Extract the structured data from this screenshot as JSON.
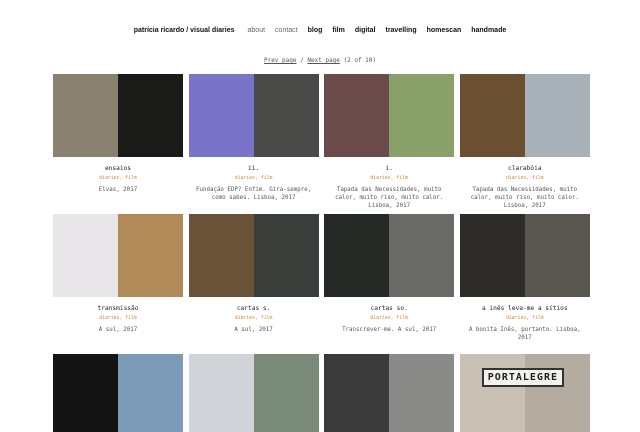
{
  "nav": {
    "site_title": "patrícia ricardo / visual diaries",
    "items": [
      "about",
      "contact",
      "blog",
      "film",
      "digital",
      "travelling",
      "homescan",
      "handmade"
    ]
  },
  "pager": {
    "prev": "Prev page",
    "sep": "/",
    "next": "Next page",
    "count": "(2 of 10)"
  },
  "tag_sep": ",",
  "posts": [
    {
      "title": "ensaios",
      "tags": [
        "diaries",
        "film"
      ],
      "desc": "Elvas, 2017",
      "left": "#8a8070",
      "right": "#1a1a18"
    },
    {
      "title": "ii.",
      "tags": [
        "diaries",
        "film"
      ],
      "desc": "Fundação EDP? Enfim. Gira-sempre, como sabes. Lisboa, 2017",
      "left": "#7a74c8",
      "right": "#4a4a48"
    },
    {
      "title": "i.",
      "tags": [
        "diaries",
        "film"
      ],
      "desc": "Tapada das Necessidades, muito calor, muito riso, muito calor. Lisboa, 2017",
      "left": "#6a4a4a",
      "right": "#8aa06a"
    },
    {
      "title": "clarabóia",
      "tags": [
        "diaries",
        "film"
      ],
      "desc": "Tapada das Necessidades, muito calor, muito riso, muito calor. Lisboa, 2017",
      "left": "#6a5030",
      "right": "#a8b0b8"
    },
    {
      "title": "transmissão",
      "tags": [
        "diaries",
        "film"
      ],
      "desc": "A sul, 2017",
      "left": "#e8e6e8",
      "right": "#b08a58"
    },
    {
      "title": "cartas s.",
      "tags": [
        "diaries",
        "film"
      ],
      "desc": "A sul, 2017",
      "left": "#6a5238",
      "right": "#3a3e3a"
    },
    {
      "title": "cartas so.",
      "tags": [
        "diaries",
        "film"
      ],
      "desc": "Transcrever-me. A sul, 2017",
      "left": "#262a26",
      "right": "#6a6a66"
    },
    {
      "title": "a inês leva-me a sítios",
      "tags": [
        "diaries",
        "film"
      ],
      "desc": "A bonita Inês, portanto. Lisboa, 2017",
      "left": "#2e2c28",
      "right": "#58564e"
    },
    {
      "title": "",
      "tags": [],
      "desc": "",
      "left": "#141414",
      "right": "#7a9ab8"
    },
    {
      "title": "",
      "tags": [],
      "desc": "",
      "left": "#d0d4d8",
      "right": "#7a8a78"
    },
    {
      "title": "",
      "tags": [],
      "desc": "",
      "left": "#3a3a3a",
      "right": "#8a8a88"
    },
    {
      "title": "",
      "tags": [],
      "desc": "",
      "left": "#c8c0b4",
      "right": "#b4aca0",
      "sign": "PORTALEGRE"
    }
  ]
}
